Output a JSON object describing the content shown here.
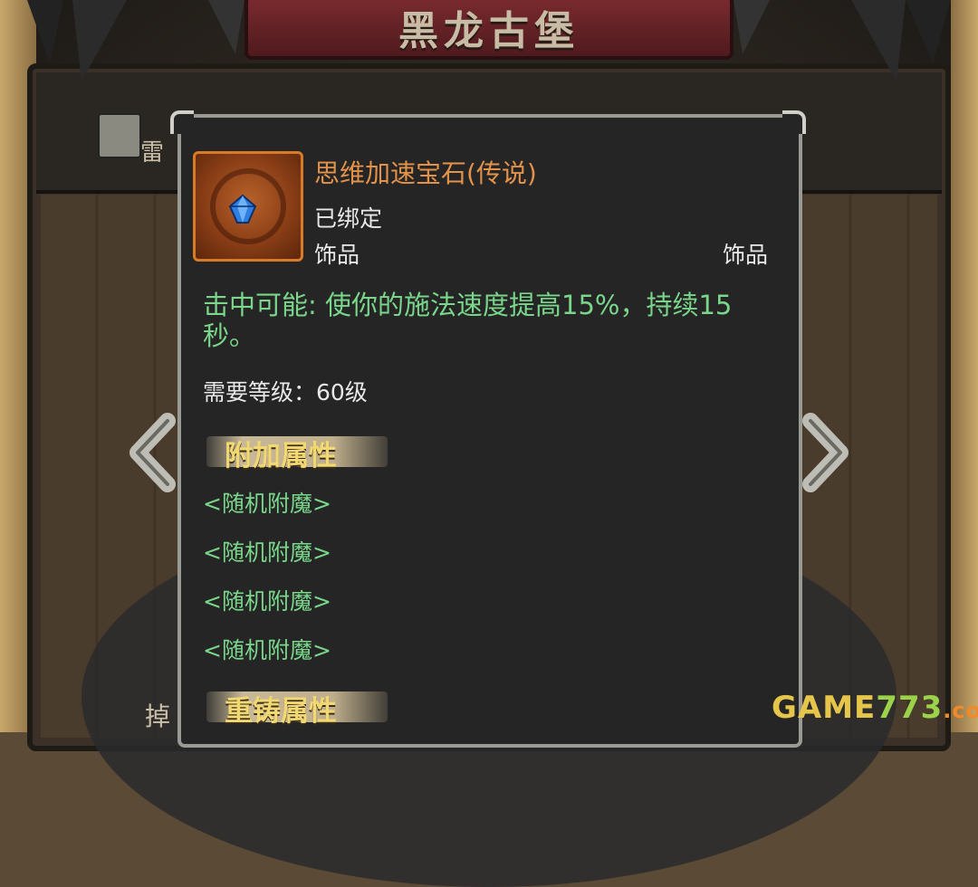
{
  "header": {
    "title": "黑龙古堡"
  },
  "background": {
    "side_tab_label": "雷",
    "bottom_left_label": "掉"
  },
  "item": {
    "name": "思维加速宝石(传说)",
    "bound_status": "已绑定",
    "type_left": "饰品",
    "type_right": "饰品",
    "rarity_color": "#e2924a",
    "icon": "blue-gem-icon",
    "effect": "击中可能: 使你的施法速度提高15%，持续15秒。",
    "level_requirement": "需要等级：60级"
  },
  "sections": {
    "bonus_attributes": {
      "title": "附加属性",
      "entries": [
        "<随机附魔>",
        "<随机附魔>",
        "<随机附魔>",
        "<随机附魔>"
      ]
    },
    "reforge_attributes": {
      "title": "重铸属性"
    }
  },
  "watermark": {
    "game": "GAME",
    "num": "773",
    "com": ".com"
  },
  "colors": {
    "effect_green": "#79d68a",
    "section_gold": "#f1d873",
    "panel_bg": "#252525"
  }
}
